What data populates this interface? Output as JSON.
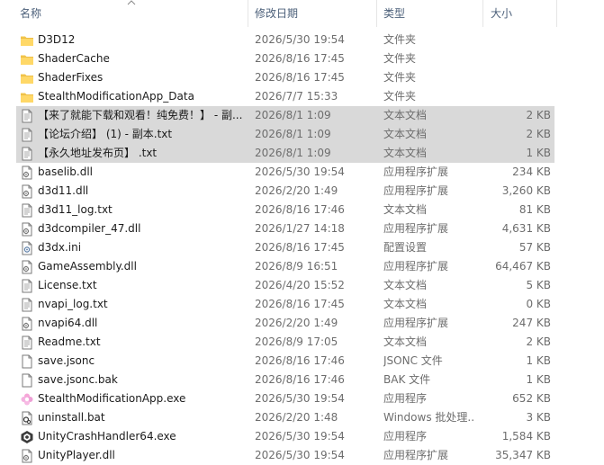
{
  "columns": {
    "name": "名称",
    "date": "修改日期",
    "type": "类型",
    "size": "大小"
  },
  "files": [
    {
      "icon": "folder-icon",
      "name": "D3D12",
      "date": "2026/5/30 19:54",
      "type": "文件夹",
      "size": "",
      "selected": false
    },
    {
      "icon": "folder-icon",
      "name": "ShaderCache",
      "date": "2026/8/16 17:45",
      "type": "文件夹",
      "size": "",
      "selected": false
    },
    {
      "icon": "folder-icon",
      "name": "ShaderFixes",
      "date": "2026/8/16 17:45",
      "type": "文件夹",
      "size": "",
      "selected": false
    },
    {
      "icon": "folder-icon",
      "name": "StealthModificationApp_Data",
      "date": "2026/7/7 15:33",
      "type": "文件夹",
      "size": "",
      "selected": false
    },
    {
      "icon": "text-file-icon",
      "name": "【来了就能下载和观看！纯免费！】 - 副...",
      "date": "2026/8/1 1:09",
      "type": "文本文档",
      "size": "2 KB",
      "selected": true
    },
    {
      "icon": "text-file-icon",
      "name": "【论坛介绍】 (1) - 副本.txt",
      "date": "2026/8/1 1:09",
      "type": "文本文档",
      "size": "2 KB",
      "selected": true
    },
    {
      "icon": "text-file-icon",
      "name": "【永久地址发布页】 .txt",
      "date": "2026/8/1 1:09",
      "type": "文本文档",
      "size": "1 KB",
      "selected": true
    },
    {
      "icon": "dll-file-icon",
      "name": "baselib.dll",
      "date": "2026/5/30 19:54",
      "type": "应用程序扩展",
      "size": "234 KB",
      "selected": false
    },
    {
      "icon": "dll-file-icon",
      "name": "d3d11.dll",
      "date": "2026/2/20 1:49",
      "type": "应用程序扩展",
      "size": "3,260 KB",
      "selected": false
    },
    {
      "icon": "text-file-icon",
      "name": "d3d11_log.txt",
      "date": "2026/8/16 17:46",
      "type": "文本文档",
      "size": "81 KB",
      "selected": false
    },
    {
      "icon": "dll-file-icon",
      "name": "d3dcompiler_47.dll",
      "date": "2026/1/27 14:18",
      "type": "应用程序扩展",
      "size": "4,631 KB",
      "selected": false
    },
    {
      "icon": "ini-file-icon",
      "name": "d3dx.ini",
      "date": "2026/8/16 17:45",
      "type": "配置设置",
      "size": "57 KB",
      "selected": false
    },
    {
      "icon": "dll-file-icon",
      "name": "GameAssembly.dll",
      "date": "2026/8/9 16:51",
      "type": "应用程序扩展",
      "size": "64,467 KB",
      "selected": false
    },
    {
      "icon": "text-file-icon",
      "name": "License.txt",
      "date": "2026/4/20 15:52",
      "type": "文本文档",
      "size": "5 KB",
      "selected": false
    },
    {
      "icon": "text-file-icon",
      "name": "nvapi_log.txt",
      "date": "2026/8/16 17:45",
      "type": "文本文档",
      "size": "0 KB",
      "selected": false
    },
    {
      "icon": "dll-file-icon",
      "name": "nvapi64.dll",
      "date": "2026/2/20 1:49",
      "type": "应用程序扩展",
      "size": "247 KB",
      "selected": false
    },
    {
      "icon": "text-file-icon",
      "name": "Readme.txt",
      "date": "2026/8/9 17:05",
      "type": "文本文档",
      "size": "2 KB",
      "selected": false
    },
    {
      "icon": "blank-file-icon",
      "name": "save.jsonc",
      "date": "2026/8/16 17:46",
      "type": "JSONC 文件",
      "size": "1 KB",
      "selected": false
    },
    {
      "icon": "blank-file-icon",
      "name": "save.jsonc.bak",
      "date": "2026/8/16 17:46",
      "type": "BAK 文件",
      "size": "1 KB",
      "selected": false
    },
    {
      "icon": "app-flower-icon",
      "name": "StealthModificationApp.exe",
      "date": "2026/5/30 19:54",
      "type": "应用程序",
      "size": "652 KB",
      "selected": false
    },
    {
      "icon": "bat-file-icon",
      "name": "uninstall.bat",
      "date": "2026/2/20 1:48",
      "type": "Windows 批处理...",
      "size": "3 KB",
      "selected": false
    },
    {
      "icon": "unity-icon",
      "name": "UnityCrashHandler64.exe",
      "date": "2026/5/30 19:54",
      "type": "应用程序",
      "size": "1,584 KB",
      "selected": false
    },
    {
      "icon": "dll-file-icon",
      "name": "UnityPlayer.dll",
      "date": "2026/5/30 19:54",
      "type": "应用程序扩展",
      "size": "35,347 KB",
      "selected": false
    }
  ]
}
